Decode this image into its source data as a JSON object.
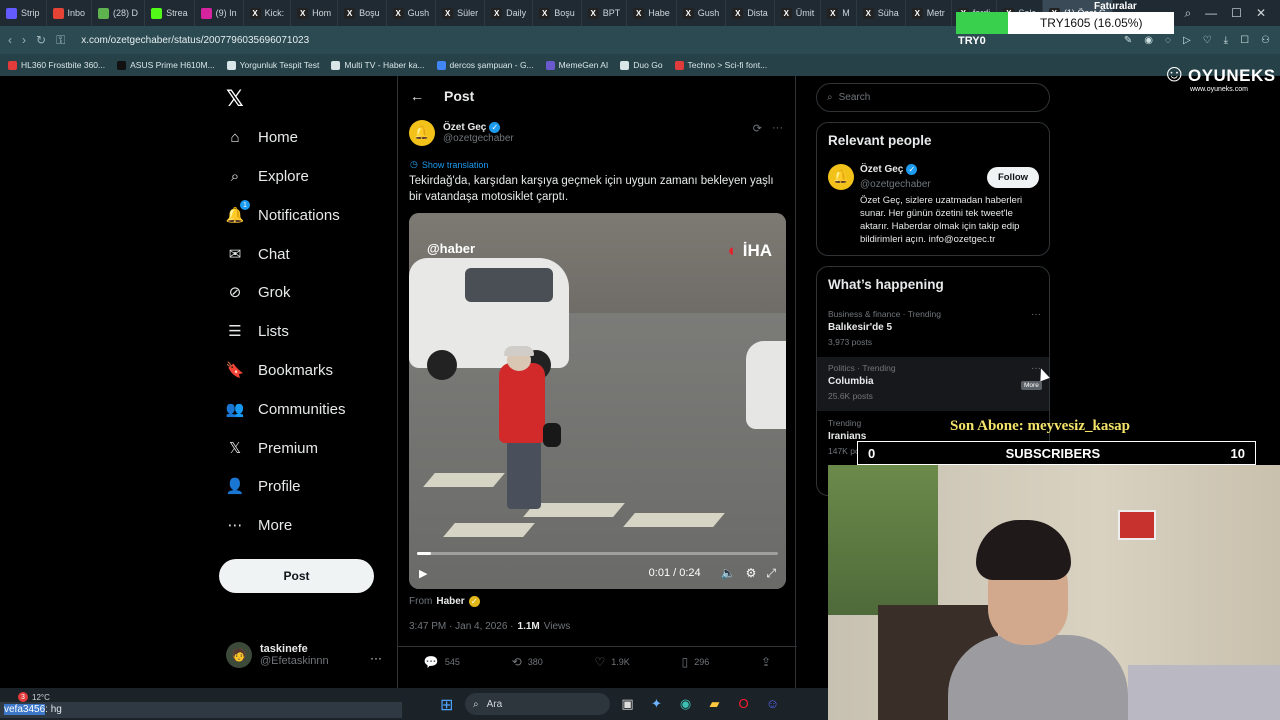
{
  "browser": {
    "tabs": [
      {
        "label": "Strip",
        "icon": "stripe-icon",
        "color": "#635bff"
      },
      {
        "label": "Inbo",
        "icon": "gmail-icon",
        "color": "#e54335"
      },
      {
        "label": "(28) D",
        "icon": "tab-icon",
        "color": "#5fb34e"
      },
      {
        "label": "Strea",
        "icon": "kick-icon",
        "color": "#53fc18"
      },
      {
        "label": "(9) In",
        "icon": "instagram-icon",
        "color": "#d6249f"
      },
      {
        "label": "Kick:",
        "icon": "x-icon",
        "color": "#222"
      },
      {
        "label": "Hom",
        "icon": "x-icon",
        "color": "#222"
      },
      {
        "label": "Boşu",
        "icon": "x-icon",
        "color": "#222"
      },
      {
        "label": "Gush",
        "icon": "x-icon",
        "color": "#222"
      },
      {
        "label": "Süler",
        "icon": "x-icon",
        "color": "#222"
      },
      {
        "label": "Daily",
        "icon": "x-icon",
        "color": "#222"
      },
      {
        "label": "Boşu",
        "icon": "x-icon",
        "color": "#222"
      },
      {
        "label": "BPT",
        "icon": "x-icon",
        "color": "#222"
      },
      {
        "label": "Habe",
        "icon": "x-icon",
        "color": "#222"
      },
      {
        "label": "Gush",
        "icon": "x-icon",
        "color": "#222"
      },
      {
        "label": "Dista",
        "icon": "x-icon",
        "color": "#222"
      },
      {
        "label": "Ümit",
        "icon": "x-icon",
        "color": "#222"
      },
      {
        "label": "M",
        "icon": "x-icon",
        "color": "#222"
      },
      {
        "label": "Süha",
        "icon": "x-icon",
        "color": "#222"
      },
      {
        "label": "Metr",
        "icon": "x-icon",
        "color": "#222"
      },
      {
        "label": "ferdi",
        "icon": "x-icon",
        "color": "#222"
      },
      {
        "label": "Solc",
        "icon": "x-icon",
        "color": "#222"
      },
      {
        "label": "(1) Özet G",
        "icon": "x-icon",
        "color": "#222",
        "active": true
      }
    ],
    "url": "x.com/ozetgechaber/status/2007796035696071023",
    "bookmarks": [
      {
        "label": "HL360 Frostbite 360...",
        "color": "#e23b3b"
      },
      {
        "label": "ASUS Prime H610M...",
        "color": "#111"
      },
      {
        "label": "Yorgunluk Tespit Test",
        "color": "#d9e6e8"
      },
      {
        "label": "Multi TV - Haber ka...",
        "color": "#d9e6e8"
      },
      {
        "label": "dercos şampuan - G...",
        "color": "#4285f4"
      },
      {
        "label": "MemeGen AI",
        "color": "#6a5acd"
      },
      {
        "label": "Duo Go",
        "color": "#d9e6e8"
      },
      {
        "label": "Techno > Sci-fi font...",
        "color": "#e23b3b"
      }
    ]
  },
  "overlays": {
    "goal_text": "TRY1605 (16.05%)",
    "goal_percent": 16.05,
    "faturalar": "Faturalar",
    "try0": "TRY0",
    "brand": "OYUNEKS",
    "brand_site": "www.oyuneks.com",
    "son_abone": "Son Abone: meyvesiz_kasap",
    "subs_left": "0",
    "subs_label": "SUBSCRIBERS",
    "subs_right": "10"
  },
  "nav": {
    "items": [
      {
        "label": "Home",
        "icon": "home-icon",
        "glyph": "⌂"
      },
      {
        "label": "Explore",
        "icon": "search-icon",
        "glyph": "⌕"
      },
      {
        "label": "Notifications",
        "icon": "bell-icon",
        "glyph": "🔔",
        "badge": "1"
      },
      {
        "label": "Chat",
        "icon": "envelope-icon",
        "glyph": "✉"
      },
      {
        "label": "Grok",
        "icon": "grok-icon",
        "glyph": "⊘"
      },
      {
        "label": "Lists",
        "icon": "list-icon",
        "glyph": "☰"
      },
      {
        "label": "Bookmarks",
        "icon": "bookmark-icon",
        "glyph": "🔖"
      },
      {
        "label": "Communities",
        "icon": "communities-icon",
        "glyph": "👥"
      },
      {
        "label": "Premium",
        "icon": "x-premium-icon",
        "glyph": "𝕏"
      },
      {
        "label": "Profile",
        "icon": "person-icon",
        "glyph": "👤"
      },
      {
        "label": "More",
        "icon": "more-circle-icon",
        "glyph": "⋯"
      }
    ],
    "post_label": "Post",
    "user_name": "taskinefe",
    "user_handle": "@Efetaskinnn"
  },
  "post": {
    "header": "Post",
    "author_name": "Özet Geç",
    "author_handle": "@ozetgechaber",
    "show_translation": "Show translation",
    "text": "Tekirdağ'da, karşıdan karşıya geçmek için uygun zamanı bekleyen yaşlı bir vatandaşa motosiklet çarptı.",
    "video_watermark_left": "@haber",
    "video_watermark_right": "İHA",
    "video_time": "0:01 / 0:24",
    "video_progress": 0.04,
    "from_label": "From",
    "from_name": "Haber",
    "time": "3:47 PM · Jan 4, 2026 ·",
    "views": "1.1M",
    "views_label": "Views",
    "replies": "545",
    "reposts": "380",
    "likes": "1.9K",
    "bookmarks": "296"
  },
  "sidebar": {
    "search_placeholder": "Search",
    "relevant_title": "Relevant people",
    "person_name": "Özet Geç",
    "person_handle": "@ozetgechaber",
    "follow_label": "Follow",
    "person_bio": "Özet Geç, sizlere uzatmadan haberleri sunar. Her günün özetini tek tweet'le aktarır. Haberdar olmak için takip edip bildirimleri açın. info@ozetgec.tr",
    "happening_title": "What’s happening",
    "trends": [
      {
        "category": "Business & finance · Trending",
        "title": "Balıkesir'de 5",
        "count": "3,973 posts"
      },
      {
        "category": "Politics · Trending",
        "title": "Columbia",
        "count": "25.6K posts"
      },
      {
        "category": "Trending",
        "title": "Iranians",
        "count": "147K posts"
      }
    ],
    "tooltip": "More"
  },
  "taskbar": {
    "temp": "12°C",
    "weather_badge": "3",
    "status_url_highlight": "vefa3456",
    "status_url_rest": ": hg",
    "search_placeholder": "Ara"
  },
  "colors": {
    "accent": "#1d9bf0",
    "background": "#000000",
    "gold_badge": "#e2b719"
  }
}
